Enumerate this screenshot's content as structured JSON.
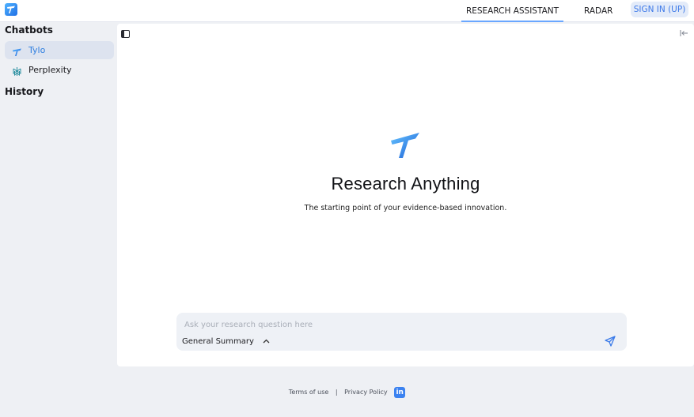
{
  "header": {
    "tabs": [
      {
        "label": "RESEARCH ASSISTANT",
        "active": true
      },
      {
        "label": "RADAR",
        "active": false
      }
    ],
    "signin_label": "SIGN IN (UP)"
  },
  "sidebar": {
    "chatbots_heading": "Chatbots",
    "items": [
      {
        "label": "Tylo",
        "icon": "tylo-logo-icon",
        "selected": true
      },
      {
        "label": "Perplexity",
        "icon": "perplexity-icon",
        "selected": false
      }
    ],
    "history_heading": "History"
  },
  "main": {
    "title": "Research Anything",
    "subtitle": "The starting point of your evidence-based innovation.",
    "input_placeholder": "Ask your research question here",
    "mode_label": "General Summary"
  },
  "footer": {
    "terms_label": "Terms of use",
    "separator": "|",
    "privacy_label": "Privacy Policy",
    "linkedin_label": "in"
  },
  "colors": {
    "accent": "#3d79e8",
    "selected_text": "#2f7fe0",
    "selected_bg": "#dde3ef",
    "page_bg": "#eef0f4"
  }
}
